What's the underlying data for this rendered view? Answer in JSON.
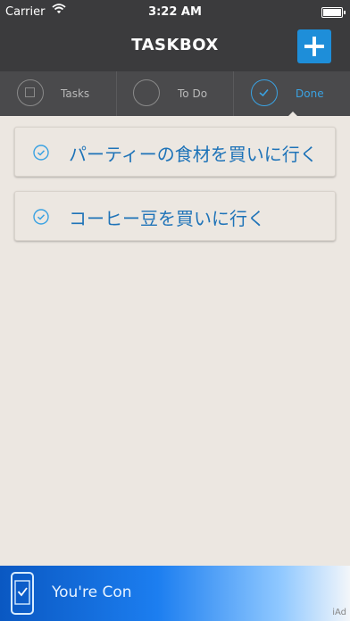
{
  "status_bar": {
    "carrier": "Carrier",
    "time": "3:22 AM"
  },
  "nav": {
    "title": "TASKBOX"
  },
  "tabs": [
    {
      "label": "Tasks",
      "selected": false,
      "icon": "tasks-icon"
    },
    {
      "label": "To Do",
      "selected": false,
      "icon": "circle-icon"
    },
    {
      "label": "Done",
      "selected": true,
      "icon": "check-circle-icon"
    }
  ],
  "tasks": [
    {
      "text": "パーティーの食材を買いに行く",
      "done": true
    },
    {
      "text": "コーヒー豆を買いに行く",
      "done": true
    }
  ],
  "ad": {
    "text": "You're Con",
    "badge": "iAd"
  },
  "colors": {
    "accent": "#1e8ed9",
    "header": "#3b3b3d",
    "background": "#ece7e1"
  }
}
